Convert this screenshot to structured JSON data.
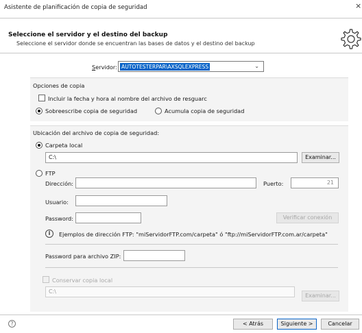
{
  "window": {
    "title": "Asistente de planificación de copia de seguridad",
    "close_glyph": "×"
  },
  "header": {
    "title": "Seleccione el servidor y el destino del backup",
    "subtitle": "Seleccione el servidor donde se encuentran las bases de datos y el destino del backup",
    "icon": "gear-icon"
  },
  "server": {
    "label": "Servidor:",
    "value": "AUTOTESTERPAR\\AXSQLEXPRESS"
  },
  "copy_options": {
    "heading": "Opciones de copia",
    "include_date_label": "Incluir la fecha y hora al nombre del archivo de resguarc",
    "include_date_checked": false,
    "overwrite_label": "Sobreescribe copia de seguridad",
    "overwrite_selected": true,
    "accumulate_label": "Acumula copia de seguridad",
    "accumulate_selected": false
  },
  "location": {
    "heading": "Ubicación del archivo de copia de seguridad:",
    "local_folder_label": "Carpeta local",
    "local_folder_selected": true,
    "local_path": "C:\\",
    "browse_label": "Examinar..."
  },
  "ftp": {
    "label": "FTP",
    "selected": false,
    "address_label": "Dirección:",
    "address_value": "",
    "port_label": "Puerto:",
    "port_value": "21",
    "user_label": "Usuario:",
    "user_value": "",
    "password_label": "Password:",
    "password_value": "",
    "verify_label": "Verificar conexión",
    "examples_text": "Ejemplos de dirección FTP: \"miServidorFTP.com/carpeta\" ó \"ftp://miServidorFTP.com.ar/carpeta\"",
    "zip_password_label": "Password  para archivo ZIP:",
    "zip_password_value": "",
    "keep_local_label": "Conservar copia local",
    "keep_local_checked": false,
    "keep_local_path": "C:\\",
    "keep_local_browse": "Examinar..."
  },
  "footer": {
    "help_glyph": "?",
    "back_label": "< Atrás",
    "next_label": "Siguiente >",
    "cancel_label": "Cancelar"
  },
  "colors": {
    "accent": "#0a64c8",
    "panel": "#f4f4f4",
    "disabled_text": "#a8a8a8"
  }
}
